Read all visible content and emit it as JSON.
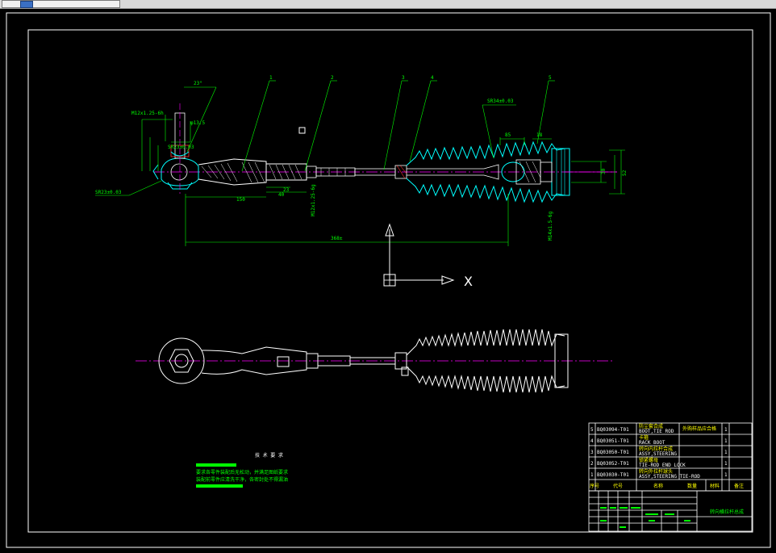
{
  "dimensions": {
    "d_total": "368±",
    "d_150": "150",
    "d_23": "23",
    "d_40": "40",
    "d_m12_left": "M12x1.25-6h",
    "d_m12_mid": "M12x1.25-6g",
    "d_m14": "M14x1.5-6g",
    "d_sr23_top": "SR23±0.03",
    "d_sr23_bot": "SR23±0.03",
    "d_sr34": "SR34±0.03",
    "d_23deg": "23°",
    "d_85": "85",
    "d_18": "18",
    "d_30": "30",
    "d_52": "52",
    "d_phi13": "φ13.5"
  },
  "callouts": [
    "1",
    "2",
    "3",
    "4",
    "5"
  ],
  "axis": {
    "x_label": "X"
  },
  "tech_req": {
    "title": "技 术 要 求",
    "line1": "要求各零件装配后无松动，并满足图纸要求",
    "line2": "装配前零件应清洗干净，各密封处不得漏油"
  },
  "bom": [
    {
      "no": "5",
      "code": "BQ03094-T01",
      "name_cn": "防尘套合成",
      "name_en": "BOOT,TIE ROD",
      "note1": "外购样品应合格",
      "qty": "1"
    },
    {
      "no": "4",
      "code": "BQ03051-T01",
      "name_cn": "卡箍",
      "name_en": "RACK BOOT",
      "note1": "",
      "qty": "1"
    },
    {
      "no": "3",
      "code": "BQ03050-T01",
      "name_cn": "转向内拉杆合成",
      "name_en": "ASSY,STEERING",
      "note1": "",
      "qty": "1"
    },
    {
      "no": "2",
      "code": "BQ03052-T01",
      "name_cn": "锁紧螺母",
      "name_en": "TIE-ROD END LOCK",
      "note1": "",
      "qty": "1"
    },
    {
      "no": "1",
      "code": "BQ03030-T01",
      "name_cn": "转向外拉杆球头",
      "name_en": "ASSY,STEERING TIE-ROD",
      "note1": "",
      "qty": "1"
    }
  ],
  "bom_header": [
    "序号",
    "代号",
    "名称",
    "数量",
    "材料",
    "备注"
  ],
  "title_block": {
    "drawing_title": "转向横拉杆总成"
  },
  "colors": {
    "frame": "#ffffff",
    "cyan": "#00ffff",
    "green": "#00ff00",
    "yellow": "#ffff00",
    "magenta": "#ff00ff",
    "red": "#ff3030",
    "white": "#ffffff"
  }
}
